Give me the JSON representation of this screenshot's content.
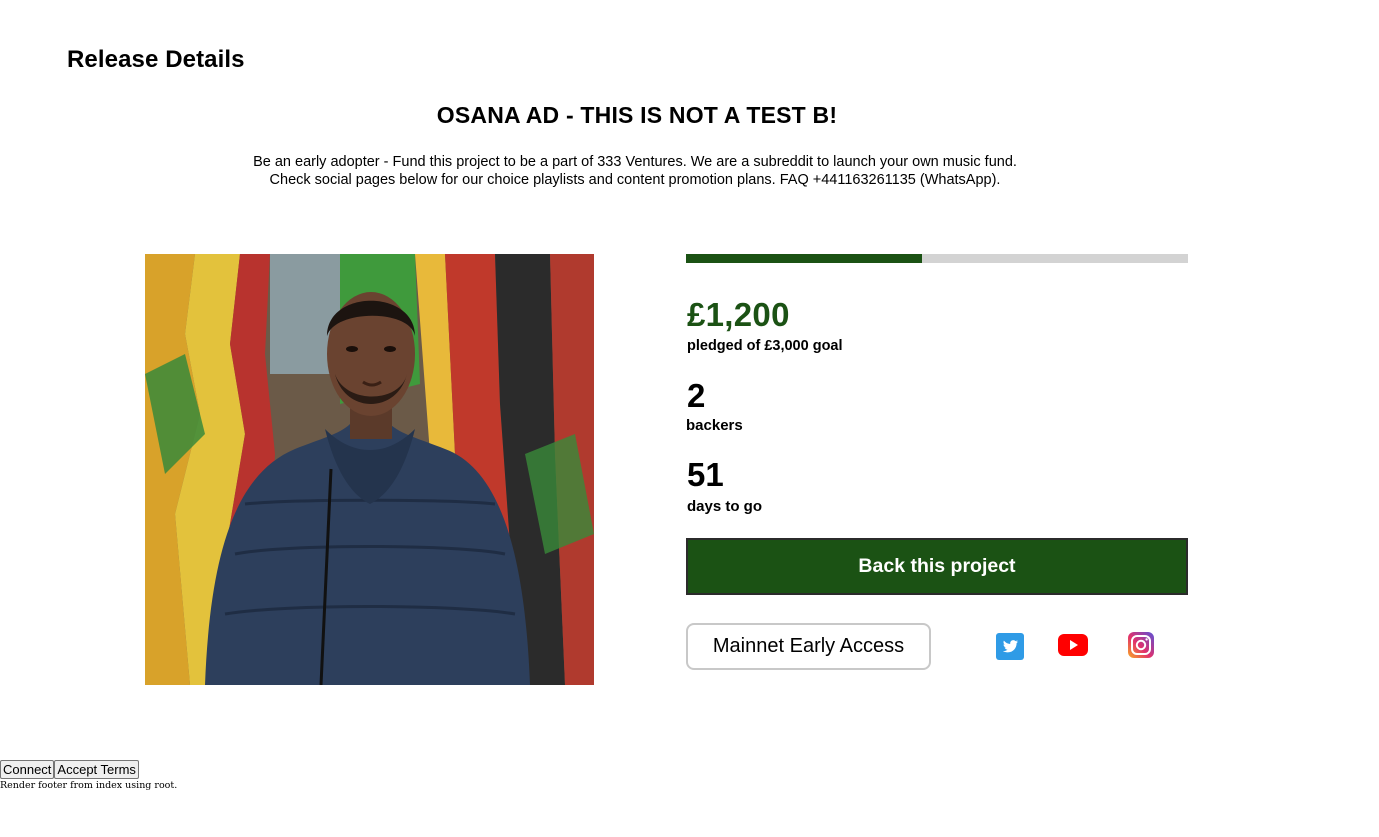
{
  "page": {
    "heading": "Release Details"
  },
  "release": {
    "title": "OSANA AD - THIS IS NOT A TEST B!",
    "description_line1": "Be an early adopter - Fund this project to be a part of 333 Ventures. We are a subreddit to launch your own music fund.",
    "description_line2": "Check social pages below for our choice playlists and content promotion plans. FAQ +441163261135 (WhatsApp)."
  },
  "image": {
    "icon": "artist-photo"
  },
  "funding": {
    "progress_percent": 47,
    "pledged": "£1,200",
    "pledged_label": "pledged of £3,000 goal",
    "backers": "2",
    "backers_label": "backers",
    "days": "51",
    "days_label": "days to go",
    "accent_color": "#1b5214",
    "track_color": "#d3d3d3"
  },
  "actions": {
    "back_label": "Back this project",
    "early_access_label": "Mainnet Early Access"
  },
  "social": {
    "items": [
      {
        "icon": "twitter-icon",
        "color": "#1da1f2"
      },
      {
        "icon": "youtube-icon",
        "color": "#ff0000"
      },
      {
        "icon": "instagram-icon",
        "color": "#c13584"
      }
    ]
  },
  "footer": {
    "connect_label": "Connect",
    "accept_label": "Accept Terms",
    "note": "Render footer from index using root."
  }
}
